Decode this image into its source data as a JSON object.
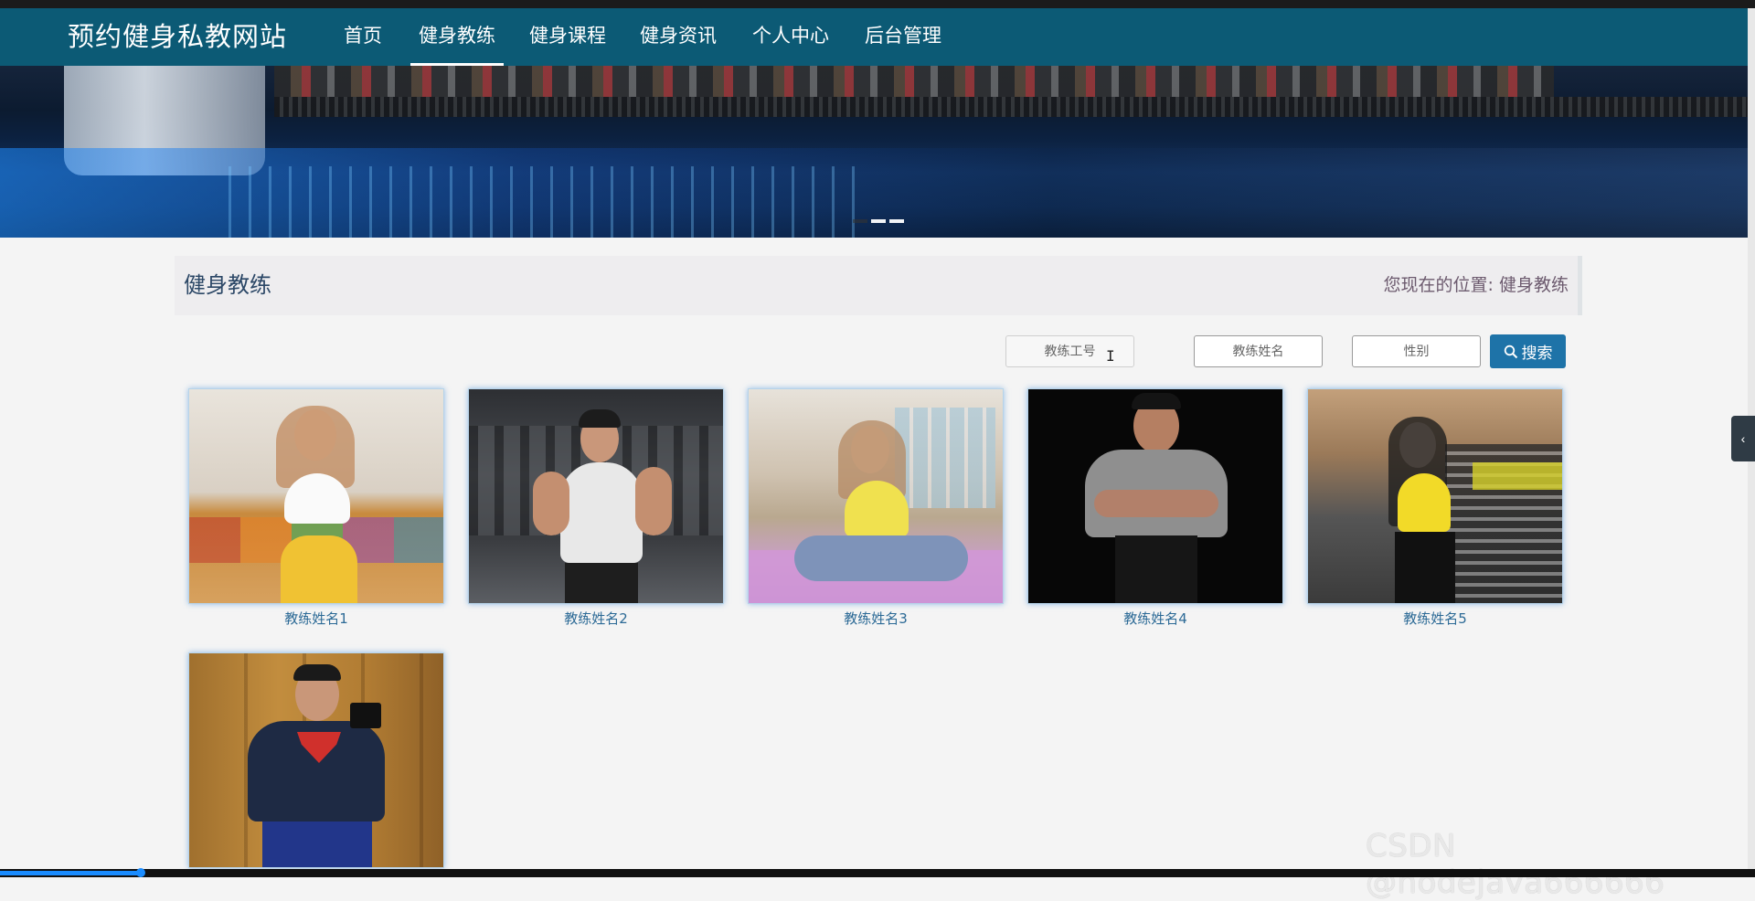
{
  "brand": "预约健身私教网站",
  "nav": {
    "items": [
      "首页",
      "健身教练",
      "健身课程",
      "健身资讯",
      "个人中心",
      "后台管理"
    ],
    "active": "健身教练"
  },
  "banner": {
    "slides": 3,
    "active_slide": 2
  },
  "page": {
    "title": "健身教练",
    "breadcrumb": "您现在的位置: 健身教练"
  },
  "search": {
    "coach_id_placeholder": "教练工号",
    "coach_name_placeholder": "教练姓名",
    "gender_placeholder": "性别",
    "button_label": "搜索"
  },
  "coaches": [
    {
      "name": "教练姓名1"
    },
    {
      "name": "教练姓名2"
    },
    {
      "name": "教练姓名3"
    },
    {
      "name": "教练姓名4"
    },
    {
      "name": "教练姓名5"
    },
    {
      "name": ""
    }
  ],
  "side_tab_icon": "chevron-left-icon",
  "watermark": "CSDN @nodejava666666",
  "video_progress": 0.08,
  "colors": {
    "navbar": "#0c5a75",
    "accent": "#1e73a8",
    "link": "#2c6a96"
  }
}
